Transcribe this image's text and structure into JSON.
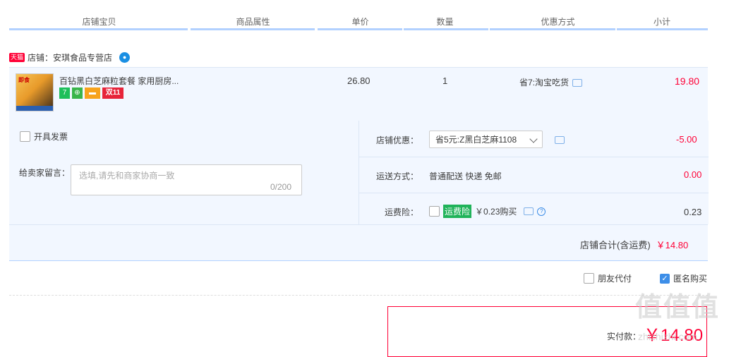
{
  "header": {
    "columns": [
      "店铺宝贝",
      "商品属性",
      "单价",
      "数量",
      "优惠方式",
      "小计"
    ]
  },
  "shop": {
    "badge": "天猫",
    "label": "店铺：安琪食品专营店"
  },
  "item": {
    "thumb_text": "即食",
    "title": "百钻黑白芝麻粒套餐 家用厨房...",
    "tags": [
      "7",
      "",
      "",
      "双11"
    ],
    "unit_price": "26.80",
    "quantity": "1",
    "discount": "省7:淘宝吃货",
    "subtotal": "19.80"
  },
  "order": {
    "invoice_label": "开具发票",
    "message_label": "给卖家留言：",
    "message_placeholder": "选填,请先和商家协商一致",
    "message_count": "0/200",
    "shop_discount_label": "店铺优惠：",
    "shop_discount_value": "省5元:Z黑白芝麻1108",
    "shop_discount_amount": "-5.00",
    "shipping_label": "运送方式：",
    "shipping_value": "普通配送 快递 免邮",
    "shipping_amount": "0.00",
    "insurance_label": "运费险：",
    "insurance_badge": "运费险",
    "insurance_value": "￥0.23购买",
    "insurance_amount": "0.23",
    "total_label": "店铺合计(含运费)",
    "total_amount": "￥14.80"
  },
  "options": {
    "friend_pay": "朋友代付",
    "anonymous": "匿名购买",
    "anonymous_checked": true
  },
  "payment": {
    "label": "实付款：",
    "amount": "￥14.80"
  },
  "watermark": {
    "mark": "值值值",
    "site": "zhizhizhi.com"
  },
  "colors": {
    "accent": "#ff0036",
    "panel": "#f2f7ff",
    "header_line": "#b2d1ff",
    "link_blue": "#3d8ee8"
  }
}
